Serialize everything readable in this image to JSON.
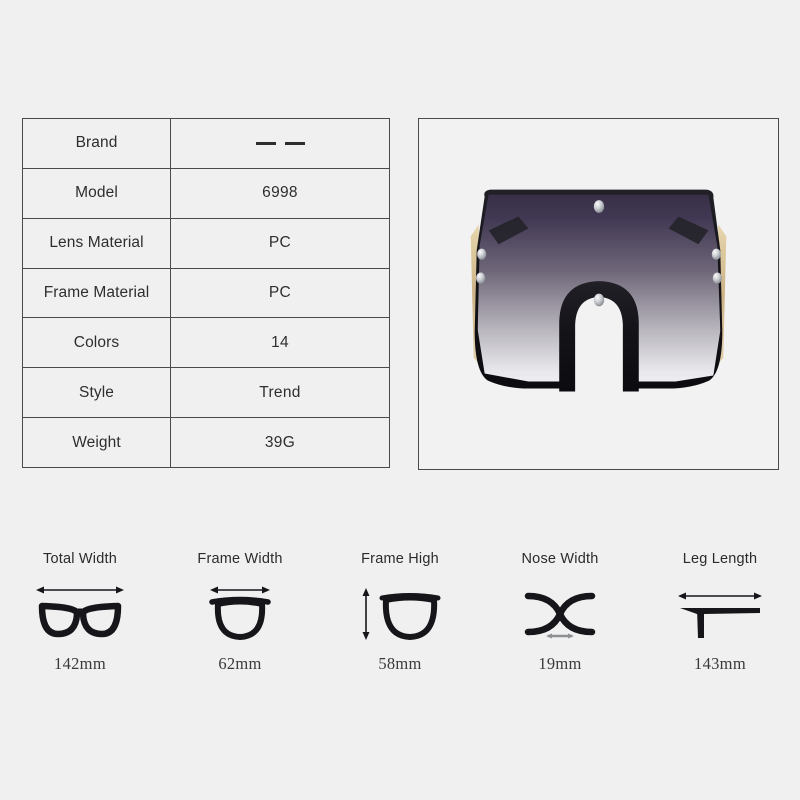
{
  "background_color": "#f0f0f0",
  "spec_table": {
    "rows": [
      {
        "label": "Brand",
        "value": "— —",
        "value_type": "dashes"
      },
      {
        "label": "Model",
        "value": "6998",
        "value_type": "text"
      },
      {
        "label": "Lens Material",
        "value": "PC",
        "value_type": "text"
      },
      {
        "label": "Frame Material",
        "value": "PC",
        "value_type": "text"
      },
      {
        "label": "Colors",
        "value": "14",
        "value_type": "text"
      },
      {
        "label": "Style",
        "value": "Trend",
        "value_type": "text"
      },
      {
        "label": "Weight",
        "value": "39G",
        "value_type": "text"
      }
    ],
    "border_color": "#4a4a4a",
    "cell_background": "#f0f0f0"
  },
  "product_photo": {
    "alt": "oversized-shield-sunglasses",
    "frame_color": "#151419",
    "lens_top_color": "#3b3246",
    "lens_bottom_color": "#f4f4f6",
    "accent_color": "#d8c39a",
    "rivet_color": "#cfd2d6",
    "panel_background": "#f2f2f2"
  },
  "measurements": [
    {
      "label": "Total Width",
      "value": "142mm",
      "icon": "full-frame-width-icon",
      "arrow": "horizontal"
    },
    {
      "label": "Frame Width",
      "value": "62mm",
      "icon": "single-lens-width-icon",
      "arrow": "horizontal"
    },
    {
      "label": "Frame High",
      "value": "58mm",
      "icon": "single-lens-height-icon",
      "arrow": "vertical"
    },
    {
      "label": "Nose Width",
      "value": "19mm",
      "icon": "nose-bridge-icon",
      "arrow": "horizontal-small"
    },
    {
      "label": "Leg Length",
      "value": "143mm",
      "icon": "temple-arm-icon",
      "arrow": "horizontal"
    }
  ]
}
